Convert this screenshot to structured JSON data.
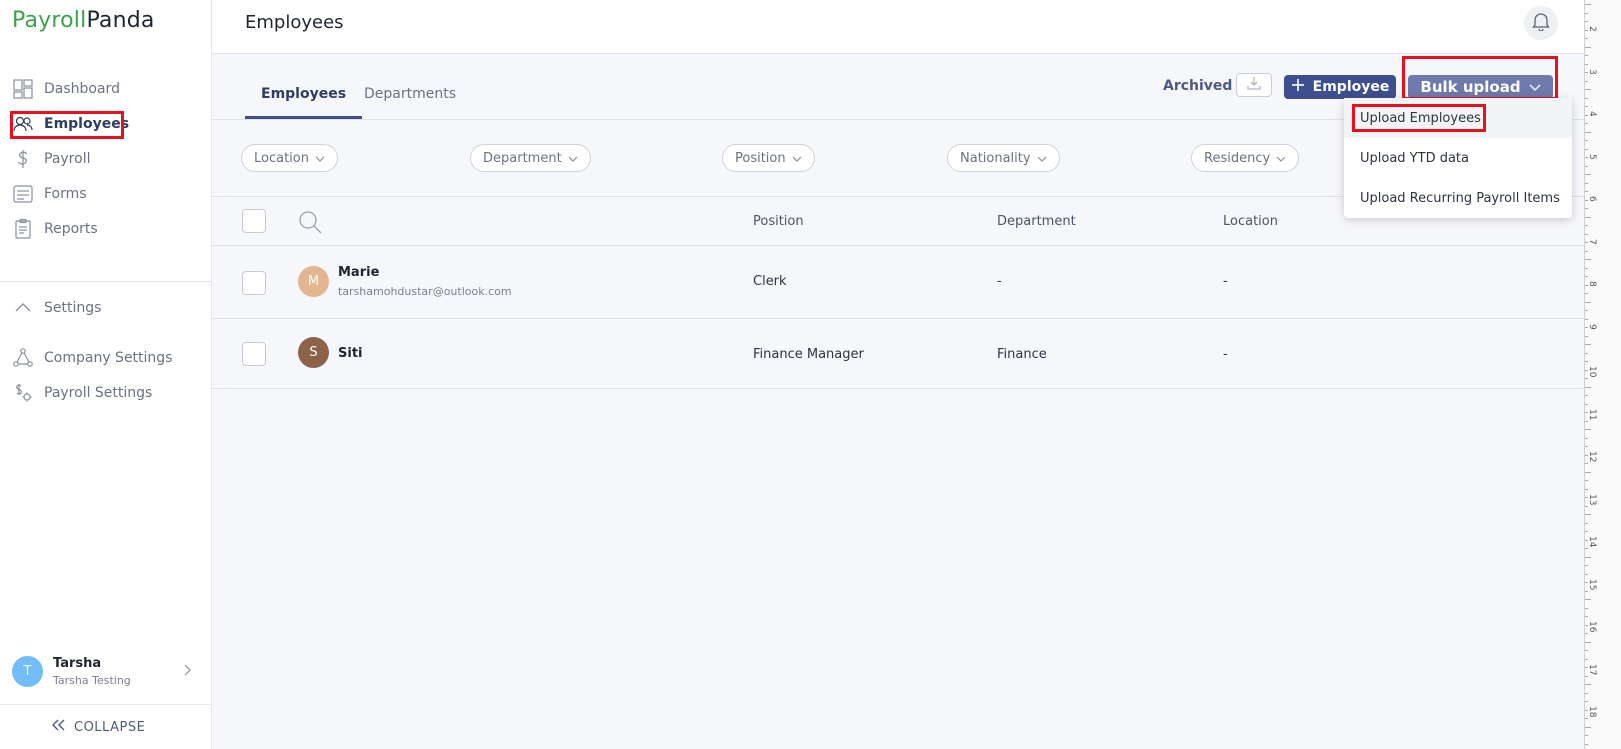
{
  "brand": {
    "part1": "Payroll",
    "part2": "Panda"
  },
  "sidebar": {
    "items": [
      {
        "label": "Dashboard",
        "icon": "dashboard-icon"
      },
      {
        "label": "Employees",
        "icon": "employees-icon"
      },
      {
        "label": "Payroll",
        "icon": "dollar-icon"
      },
      {
        "label": "Forms",
        "icon": "forms-icon"
      },
      {
        "label": "Reports",
        "icon": "reports-icon"
      }
    ],
    "settings_label": "Settings",
    "settings_items": [
      {
        "label": "Company Settings",
        "icon": "company-settings-icon"
      },
      {
        "label": "Payroll Settings",
        "icon": "payroll-settings-icon"
      }
    ],
    "user": {
      "initial": "T",
      "name": "Tarsha",
      "company": "Tarsha Testing"
    },
    "collapse_label": "COLLAPSE"
  },
  "header": {
    "title": "Employees"
  },
  "tabs": [
    {
      "label": "Employees"
    },
    {
      "label": "Departments"
    }
  ],
  "actions": {
    "archived": "Archived",
    "add_employee": "Employee",
    "bulk_upload": "Bulk upload"
  },
  "filters": [
    "Location",
    "Department",
    "Position",
    "Nationality",
    "Residency"
  ],
  "table": {
    "columns": [
      "Position",
      "Department",
      "Location"
    ],
    "rows": [
      {
        "initial": "M",
        "name": "Marie",
        "email": "tarshamohdustar@outlook.com",
        "position": "Clerk",
        "department": "-",
        "location": "-"
      },
      {
        "initial": "S",
        "name": "Siti",
        "email": "",
        "position": "Finance Manager",
        "department": "Finance",
        "location": "-"
      }
    ]
  },
  "dropdown": {
    "items": [
      "Upload Employees",
      "Upload YTD data",
      "Upload Recurring Payroll Items"
    ]
  },
  "ruler": {
    "labels": [
      "2",
      "3",
      "4",
      "5",
      "6",
      "7",
      "8",
      "9",
      "10",
      "11",
      "12",
      "13",
      "14",
      "15",
      "16",
      "17",
      "18"
    ]
  },
  "colors": {
    "brand_green": "#3aa34a",
    "primary": "#3d4f8e",
    "bulk": "#6d7aab",
    "highlight": "#e8101d"
  }
}
